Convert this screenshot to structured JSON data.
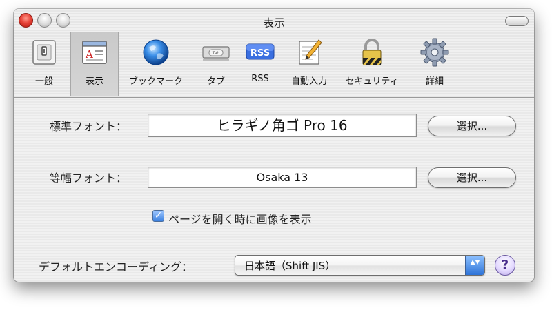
{
  "window": {
    "title": "表示"
  },
  "toolbar": {
    "items": [
      {
        "label": "一般",
        "icon": "general-switch-icon"
      },
      {
        "label": "表示",
        "icon": "appearance-icon",
        "selected": true
      },
      {
        "label": "ブックマーク",
        "icon": "globe-icon"
      },
      {
        "label": "タブ",
        "icon": "tab-icon"
      },
      {
        "label": "RSS",
        "icon": "rss-icon"
      },
      {
        "label": "自動入力",
        "icon": "autofill-pencil-icon"
      },
      {
        "label": "セキュリティ",
        "icon": "lock-icon"
      },
      {
        "label": "詳細",
        "icon": "gear-icon"
      }
    ],
    "rss_badge": "RSS",
    "tab_badge": "Tab"
  },
  "standard_font": {
    "label": "標準フォント：",
    "value": "ヒラギノ角ゴ Pro 16",
    "button": "選択..."
  },
  "fixed_font": {
    "label": "等幅フォント：",
    "value": "Osaka 13",
    "button": "選択..."
  },
  "show_images": {
    "label": "ページを開く時に画像を表示",
    "checked": true,
    "mark": "✓"
  },
  "encoding": {
    "label": "デフォルトエンコーディング：",
    "value": "日本語（Shift JIS）",
    "arrows": "▲▼"
  },
  "help": {
    "label": "?"
  },
  "colors": {
    "accent_blue": "#3d82e0",
    "close_red": "#e8453a",
    "help_purple": "#b9a8e6"
  }
}
